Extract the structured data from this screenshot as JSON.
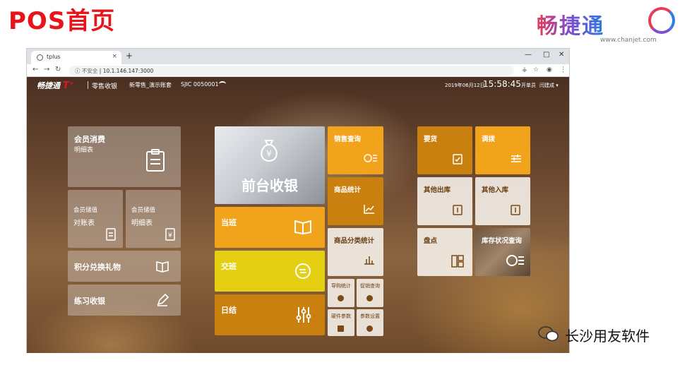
{
  "slide": {
    "title": "POS首页"
  },
  "brand": {
    "name": "畅捷通",
    "url": "www.chanjet.com"
  },
  "browser": {
    "tab_title": "tplus",
    "tab_close": "×",
    "new_tab": "+",
    "insecure_label": "不安全",
    "url": "10.1.146.147:3000"
  },
  "app": {
    "logo_text": "畅捷通",
    "logo_t": "T⁺",
    "mode": "零售收银",
    "store": "新零售_演示账套",
    "terminal_id": "SJIC 0050001",
    "date": "2019年06月12日",
    "time": "15:58:45",
    "shift_label": "开单员",
    "user": "闫建成"
  },
  "tiles": {
    "member_consume": {
      "title": "会员消费",
      "subtitle": "明细表"
    },
    "member_store_recon": {
      "title": "会员储值",
      "subtitle": "对账表"
    },
    "member_store_detail": {
      "title": "会员储值",
      "subtitle": "明细表"
    },
    "points_exchange": {
      "title": "积分兑换礼物"
    },
    "practice_cashier": {
      "title": "练习收银"
    },
    "front_cashier": {
      "title": "前台收银"
    },
    "on_duty": {
      "title": "当班"
    },
    "handover": {
      "title": "交班"
    },
    "daily_settle": {
      "title": "日结"
    },
    "sales_query": {
      "title": "销售查询"
    },
    "product_stats": {
      "title": "商品统计"
    },
    "category_stats": {
      "title": "商品分类统计"
    },
    "guide_stats": {
      "title": "导购统计"
    },
    "promo_query": {
      "title": "促销查询"
    },
    "hardware_params": {
      "title": "硬件参数"
    },
    "param_settings": {
      "title": "参数设置"
    },
    "requisition": {
      "title": "要货"
    },
    "transfer": {
      "title": "调拨"
    },
    "other_out": {
      "title": "其他出库"
    },
    "other_in": {
      "title": "其他入库"
    },
    "stocktake": {
      "title": "盘点"
    },
    "stock_query": {
      "title": "库存状况查询"
    }
  },
  "watermark": {
    "text": "长沙用友软件"
  },
  "colors": {
    "accent_red": "#e8141c",
    "tile_orange": "#f1a41b",
    "tile_yellow": "#e4cf13",
    "tile_deep_orange": "#c9800f"
  }
}
